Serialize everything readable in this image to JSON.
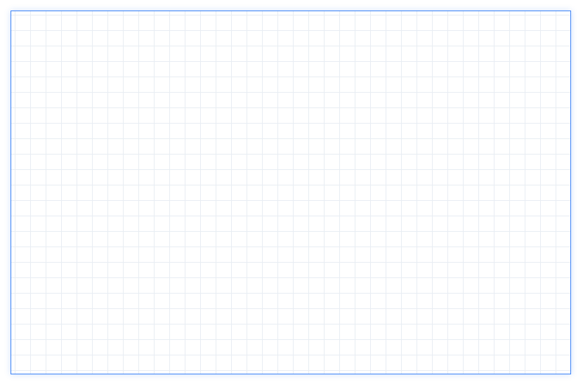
{
  "canvas": {
    "grid_visible": true,
    "border_color": "#3b82f6",
    "grid_line_color": "#e8edf3"
  }
}
